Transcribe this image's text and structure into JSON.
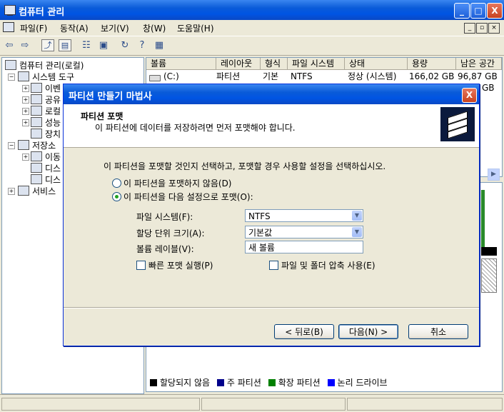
{
  "main_window": {
    "title": "컴퓨터 관리",
    "buttons": {
      "minimize": "_",
      "maximize": "□",
      "close": "X"
    }
  },
  "menu": [
    {
      "label": "파일(F)"
    },
    {
      "label": "동작(A)"
    },
    {
      "label": "보기(V)"
    },
    {
      "label": "창(W)"
    },
    {
      "label": "도움말(H)"
    }
  ],
  "toolbar_icons": [
    "back-icon",
    "forward-icon",
    "up-folder-icon",
    "show-hide-tree-icon",
    "properties-icon",
    "export-list-icon",
    "refresh-icon",
    "help-icon",
    "disk-settings-icon"
  ],
  "tree": {
    "root": "컴퓨터 관리(로컬)",
    "system_tools": "시스템 도구",
    "system_children": [
      "이벤",
      "공유",
      "로컬",
      "성능",
      "장치"
    ],
    "storage": "저장소",
    "storage_children": [
      "이동",
      "디스",
      "디스"
    ],
    "services": "서비스"
  },
  "volume_list": {
    "columns": [
      "볼륨",
      "레이아웃",
      "형식",
      "파일 시스템",
      "상태",
      "용량",
      "남은 공간"
    ],
    "rows": [
      {
        "volume": "(C:)",
        "layout": "파티션",
        "type": "기본",
        "fs": "NTFS",
        "status": "정상 (시스템)",
        "capacity": "166,02 GB",
        "free": "96,87 GB"
      }
    ],
    "partial_free": "GB"
  },
  "legend": [
    {
      "label": "할당되지 않음",
      "color": "#000000"
    },
    {
      "label": "주 파티션",
      "color": "#00008b"
    },
    {
      "label": "확장 파티션",
      "color": "#008000"
    },
    {
      "label": "논리 드라이브",
      "color": "#0000ff"
    }
  ],
  "dialog": {
    "title": "파티션 만들기 마법사",
    "close": "X",
    "header_title": "파티션 포맷",
    "header_subtitle": "이 파티션에 데이터를 저장하려면 먼저 포맷해야 합니다.",
    "instruction": "이 파티션을 포맷할 것인지 선택하고, 포맷할 경우 사용할 설정을 선택하십시오.",
    "radio_no_format": "이 파티션을 포맷하지 않음(D)",
    "radio_format": "이 파티션을 다음 설정으로 포맷(O):",
    "selected_radio": "format",
    "fields": {
      "filesystem_label": "파일 시스템(F):",
      "filesystem_value": "NTFS",
      "alloc_label": "할당 단위 크기(A):",
      "alloc_value": "기본값",
      "volume_label_label": "볼륨 레이블(V):",
      "volume_label_value": "새 볼륨"
    },
    "quick_format": "빠른 포맷 실행(P)",
    "compression": "파일 및 폴더 압축 사용(E)",
    "buttons": {
      "back": "< 뒤로(B)",
      "next": "다음(N) >",
      "cancel": "취소"
    }
  }
}
